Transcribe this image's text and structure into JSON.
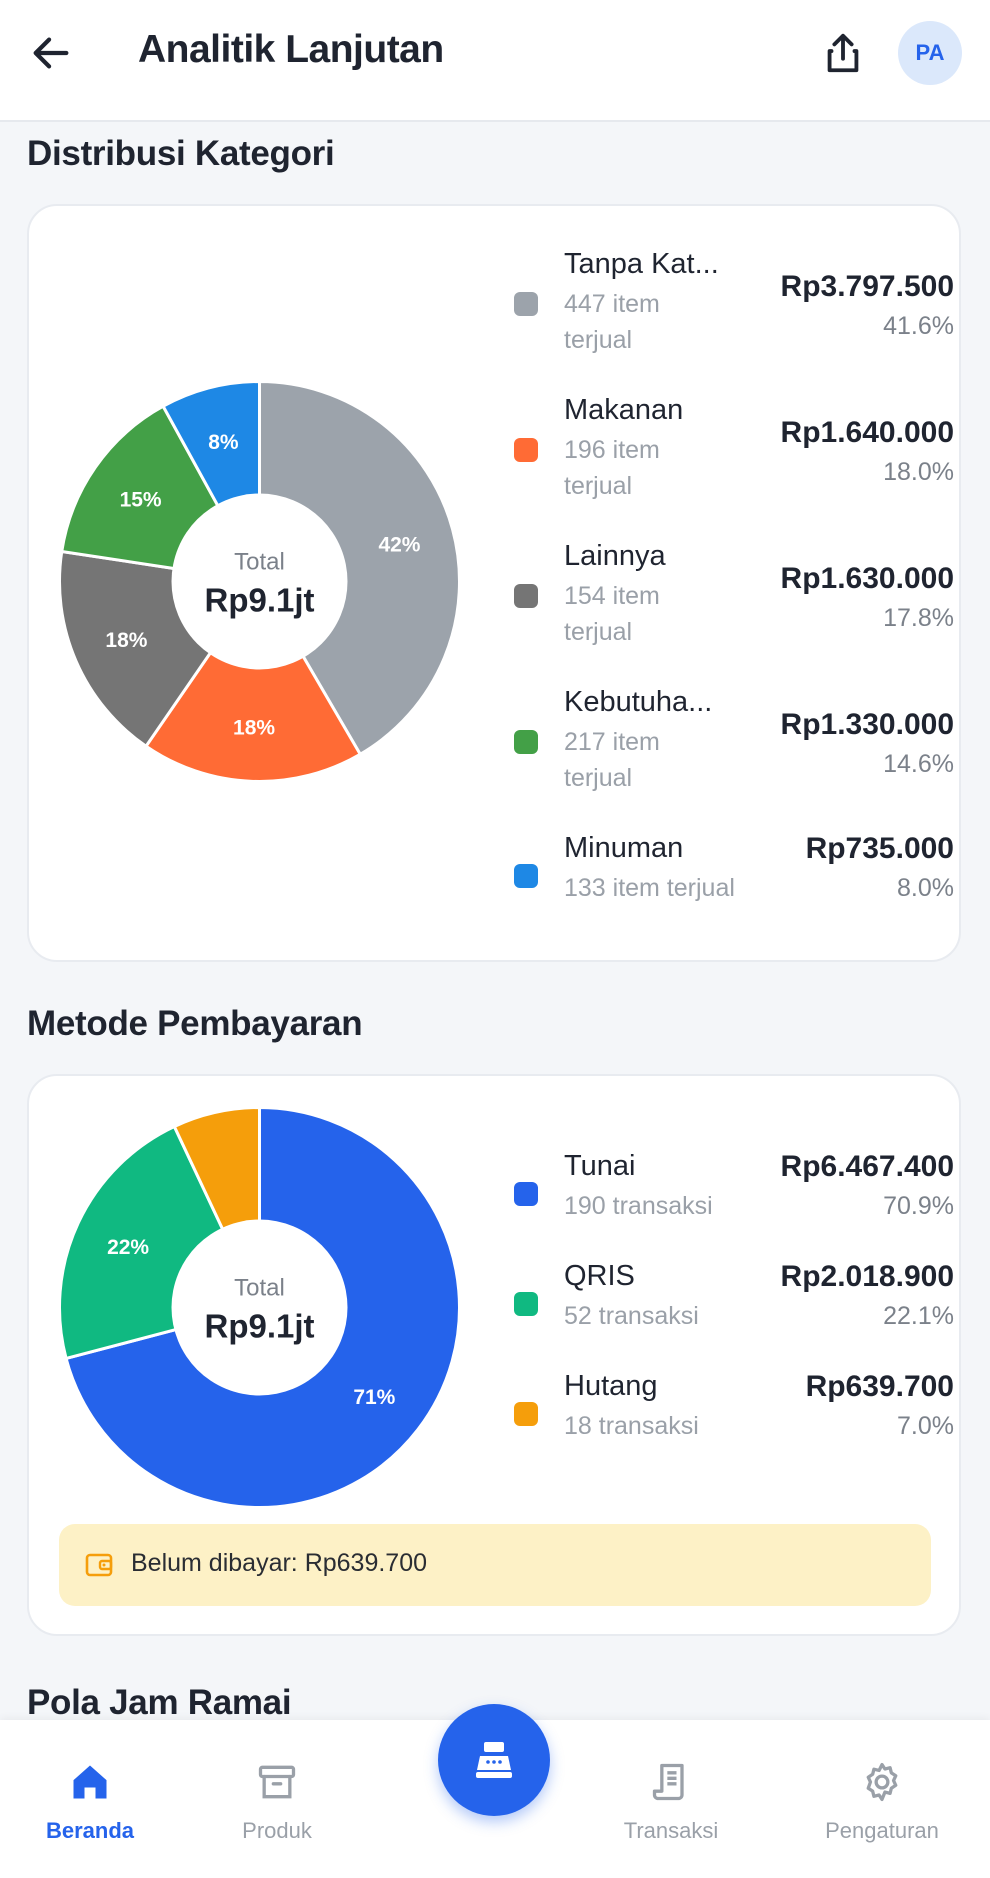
{
  "appbar": {
    "title": "Analitik Lanjutan",
    "avatar_initials": "PA",
    "back_icon": "arrow-left-icon",
    "share_icon": "share-icon"
  },
  "category_section": {
    "title": "Distribusi Kategori",
    "center_label": "Total",
    "center_value": "Rp9.1jt",
    "items": [
      {
        "name": "Tanpa Kat...",
        "sub": "447 item terjual",
        "amount": "Rp3.797.500",
        "percent": "41.6%",
        "slice_label": "42%",
        "value": 41.6,
        "color": "#9ca3ab"
      },
      {
        "name": "Makanan",
        "sub": "196 item terjual",
        "amount": "Rp1.640.000",
        "percent": "18.0%",
        "slice_label": "18%",
        "value": 18.0,
        "color": "#ff6b35"
      },
      {
        "name": "Lainnya",
        "sub": "154 item terjual",
        "amount": "Rp1.630.000",
        "percent": "17.8%",
        "slice_label": "18%",
        "value": 17.8,
        "color": "#757575"
      },
      {
        "name": "Kebutuha...",
        "sub": "217 item terjual",
        "amount": "Rp1.330.000",
        "percent": "14.6%",
        "slice_label": "15%",
        "value": 14.6,
        "color": "#43a047"
      },
      {
        "name": "Minuman",
        "sub": "133 item terjual",
        "amount": "Rp735.000",
        "percent": "8.0%",
        "slice_label": "8%",
        "value": 8.0,
        "color": "#1e88e5"
      }
    ]
  },
  "payment_section": {
    "title": "Metode Pembayaran",
    "center_label": "Total",
    "center_value": "Rp9.1jt",
    "items": [
      {
        "name": "Tunai",
        "sub": "190 transaksi",
        "amount": "Rp6.467.400",
        "percent": "70.9%",
        "slice_label": "71%",
        "value": 70.9,
        "color": "#2563eb"
      },
      {
        "name": "QRIS",
        "sub": "52 transaksi",
        "amount": "Rp2.018.900",
        "percent": "22.1%",
        "slice_label": "22%",
        "value": 22.1,
        "color": "#10b981"
      },
      {
        "name": "Hutang",
        "sub": "18 transaksi",
        "amount": "Rp639.700",
        "percent": "7.0%",
        "slice_label": "",
        "value": 7.0,
        "color": "#f59e0b"
      }
    ],
    "unpaid_text": "Belum dibayar: Rp639.700",
    "unpaid_icon": "wallet-icon"
  },
  "peak_section": {
    "title": "Pola Jam Ramai"
  },
  "bottom_nav": {
    "items": [
      {
        "label": "Beranda",
        "icon": "home-icon",
        "active": true
      },
      {
        "label": "Produk",
        "icon": "archive-box-icon",
        "active": false
      },
      {
        "label": "Transaksi",
        "icon": "receipt-icon",
        "active": false
      },
      {
        "label": "Pengaturan",
        "icon": "gear-icon",
        "active": false
      }
    ],
    "fab_icon": "cash-register-icon"
  },
  "colors": {
    "primary": "#2563eb",
    "warning_bg": "#fdf1c6",
    "warning_icon": "#f59e0b"
  }
}
